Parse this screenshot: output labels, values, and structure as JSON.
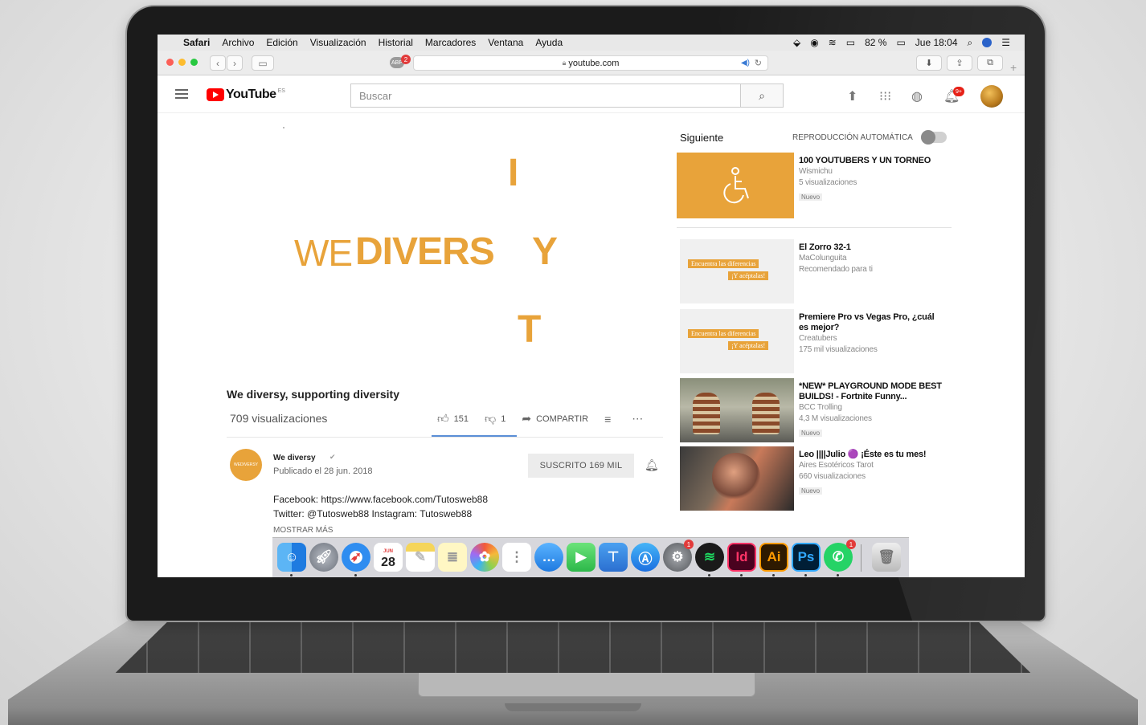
{
  "menubar": {
    "app": "Safari",
    "items": [
      "Archivo",
      "Edición",
      "Visualización",
      "Historial",
      "Marcadores",
      "Ventana",
      "Ayuda"
    ],
    "battery": "82 %",
    "clock": "Jue 18:04"
  },
  "browser": {
    "url": "youtube.com",
    "adblock_badge": "2"
  },
  "youtube": {
    "logo": "YouTube",
    "region": "ES",
    "search_placeholder": "Buscar",
    "notif_badge": "9+"
  },
  "video": {
    "logo_we": "WE",
    "logo_divers": "DIVERS",
    "logo_i": "I",
    "logo_y": "Y",
    "logo_t": "T",
    "title": "We diversy, supporting diversity",
    "views": "709 visualizaciones",
    "likes": "151",
    "dislikes": "1",
    "share": "COMPARTIR",
    "channel": "We diversy",
    "channel_avatar": "WEDIVERSY",
    "published": "Publicado el 28 jun. 2018",
    "subscribe": "SUSCRITO  169 MIL",
    "description_line1": "Facebook: https://www.facebook.com/Tutosweb88",
    "description_line2": "Twitter: @Tutosweb88     Instagram: Tutosweb88",
    "show_more": "MOSTRAR MÁS"
  },
  "sidebar": {
    "heading": "Siguiente",
    "autoplay": "REPRODUCCIÓN AUTOMÁTICA",
    "overlay_line1": "Encuentra las diferencias",
    "overlay_line2": "¡Y acéptalas!",
    "items": [
      {
        "title": "100 YOUTUBERS Y UN TORNEO",
        "channel": "Wismichu",
        "meta": "5 visualizaciones",
        "badge": "Nuevo"
      },
      {
        "title": "El Zorro 32-1",
        "channel": "MaColunguita",
        "meta": "Recomendado para ti",
        "badge": ""
      },
      {
        "title": "Premiere Pro vs Vegas Pro, ¿cuál es mejor?",
        "channel": "Creatubers",
        "meta": "175 mil visualizaciones",
        "badge": ""
      },
      {
        "title": "*NEW* PLAYGROUND MODE BEST BUILDS! - Fortnite Funny...",
        "channel": "BCC Trolling",
        "meta": "4,3 M visualizaciones",
        "badge": "Nuevo"
      },
      {
        "title": "Leo ||||Julio 🟣 ¡Éste es tu mes!",
        "channel": "Aires Esotéricos Tarot",
        "meta": "660 visualizaciones",
        "badge": "Nuevo"
      }
    ]
  },
  "dock": {
    "calendar_month": "JUN",
    "calendar_day": "28",
    "indesign": "Id",
    "illustrator": "Ai",
    "photoshop": "Ps",
    "settings_badge": "1",
    "whatsapp_badge": "1"
  },
  "colors": {
    "brand": "#e8a33a",
    "youtube_red": "#ff0000"
  }
}
